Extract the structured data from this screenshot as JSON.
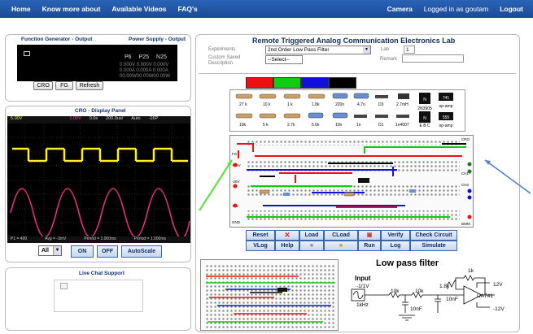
{
  "nav": {
    "home": "Home",
    "about": "Know more about",
    "videos": "Available Videos",
    "faqs": "FAQ's",
    "camera": "Camera",
    "logged_in": "Logged in as goutam",
    "logout": "Logout"
  },
  "fg": {
    "title_left": "Function Generator - Output",
    "title_right": "Power Supply - Output",
    "ch_labels": [
      "P6",
      "P25",
      "N25"
    ],
    "rows": [
      "0.000V 0.000V 0.000V",
      "0.000A 0.000A 0.000A",
      "00.00W00.00W00.00W"
    ],
    "buttons": [
      "CRO",
      "FG",
      "Refresh"
    ]
  },
  "cro": {
    "title": "CRO - Display Panel",
    "top_readouts": [
      "5.00V",
      "1.00V",
      "0.0s",
      "200.0us/",
      "Auto",
      "-16P"
    ],
    "bottom_readouts": [
      "P1 = 400",
      "Avg = -3mV",
      "Period = 1.000ms",
      "Period = 1.000ms"
    ],
    "select_value": "All",
    "buttons": [
      "ON",
      "OFF",
      "AutoScale"
    ]
  },
  "chat": {
    "title": "Live Chat Support"
  },
  "lab": {
    "title": "Remote Triggered Analog Communication Electronics Lab",
    "experiments_label": "Experiments",
    "experiment_value": "2nd Order Low Pass Filter",
    "lab_label": "Lab",
    "lab_value": "1",
    "saved_label": "Custom Saved Description",
    "saved_value": "--Select--",
    "remark_label": "Remark",
    "colors": [
      "#ee1111",
      "#11cc11",
      "#1111dd",
      "#000000"
    ],
    "components": [
      {
        "label": "27 k"
      },
      {
        "label": "10 k"
      },
      {
        "label": "1 k"
      },
      {
        "label": "1.8k"
      },
      {
        "label": "220n"
      },
      {
        "label": "4.7n"
      },
      {
        "label": "D3"
      },
      {
        "label": "2.7mH"
      },
      {
        "label": "741"
      },
      {
        "label": "10k"
      },
      {
        "label": "5 k"
      },
      {
        "label": "2.7k"
      },
      {
        "label": "5.6k"
      },
      {
        "label": "10n"
      },
      {
        "label": "1n"
      },
      {
        "label": "D1"
      },
      {
        "label": "D2"
      },
      {
        "label": "1n4007"
      },
      {
        "label": "2N2222"
      },
      {
        "label": "op-amp"
      }
    ],
    "comp_chips": [
      "N",
      "2N3905",
      "E B C",
      "741",
      "555",
      "op-amp"
    ],
    "bb_labels": {
      "left": [
        "+25V",
        "-25V",
        "+6V",
        "GND",
        "FG"
      ],
      "right": [
        "CRO",
        "CH1",
        "CH2",
        "DMM"
      ]
    },
    "toolbar_row1": [
      "Reset",
      "",
      "Load",
      "CLoad",
      "",
      "Verify",
      "Check Circuit"
    ],
    "toolbar_row2": [
      "VLog",
      "Help",
      "",
      "",
      "Run",
      "Log",
      "Simulate"
    ],
    "circuit_title": "Low pass filter",
    "circuit": {
      "input": "Input",
      "input_v": "-1/1V",
      "freq": "1kHz",
      "r1": "10k",
      "r2": "10k",
      "c1": "10nF",
      "c2": "10nF",
      "r3": "1.8k",
      "r4": "1k",
      "vcc": "12V",
      "vee": "-12V",
      "opamp": "UA741"
    }
  }
}
